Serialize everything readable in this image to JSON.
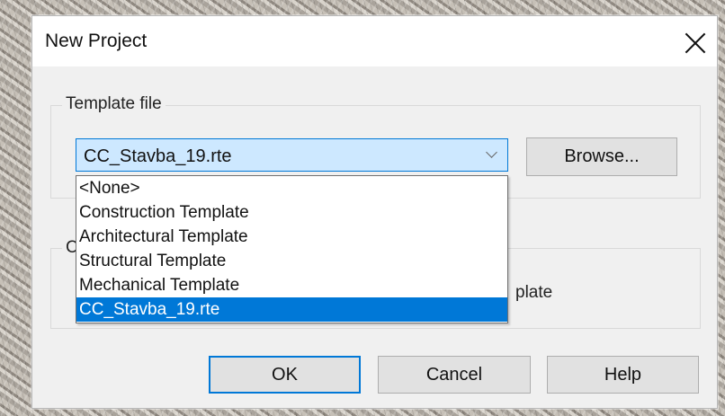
{
  "window": {
    "title": "New Project"
  },
  "template_group": {
    "label": "Template file",
    "combo": {
      "value": "CC_Stavba_19.rte"
    },
    "browse_label": "Browse...",
    "dropdown_options": [
      "<None>",
      "Construction Template",
      "Architectural Template",
      "Structural Template",
      "Mechanical Template",
      "CC_Stavba_19.rte"
    ]
  },
  "create_group": {
    "label": "C",
    "partial_text": "plate"
  },
  "buttons": {
    "ok": "OK",
    "cancel": "Cancel",
    "help": "Help"
  },
  "colors": {
    "selected": "#0078d7",
    "combo_background": "#cde8ff"
  },
  "icons": {
    "close": "close-icon",
    "dropdown": "chevron-down-icon"
  }
}
